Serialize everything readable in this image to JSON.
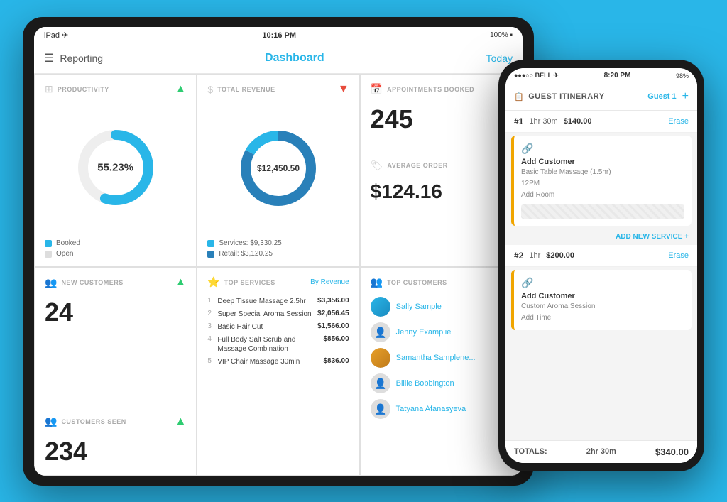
{
  "tablet": {
    "status": {
      "left": "iPad ✈",
      "time": "10:16 PM",
      "battery": "100% ▪"
    },
    "nav": {
      "menu_icon": "☰",
      "title_left": "Reporting",
      "title_center": "Dashboard",
      "title_right": "Today"
    },
    "productivity": {
      "label": "PRODUCTIVITY",
      "value": "55.23%",
      "booked_label": "Booked",
      "open_label": "Open",
      "booked_pct": 55.23,
      "trend": "up"
    },
    "revenue": {
      "label": "TOTAL REVENUE",
      "value": "$12,450.50",
      "services_label": "Services: $9,330.25",
      "retail_label": "Retail: $3,120.25",
      "trend": "down"
    },
    "appointments": {
      "label": "APPOINTMENTS BOOKED",
      "value": "245",
      "trend": "up"
    },
    "new_customers": {
      "label": "NEW CUSTOMERS",
      "value": "24",
      "trend": "up"
    },
    "top_services": {
      "label": "TOP SERVICES",
      "filter": "By Revenue",
      "items": [
        {
          "rank": 1,
          "name": "Deep Tissue Massage 2.5hr",
          "price": "$3,356.00"
        },
        {
          "rank": 2,
          "name": "Super Special Aroma Session",
          "price": "$2,056.45"
        },
        {
          "rank": 3,
          "name": "Basic Hair Cut",
          "price": "$1,566.00"
        },
        {
          "rank": 4,
          "name": "Full Body Salt Scrub and Massage Combination",
          "price": "$856.00"
        },
        {
          "rank": 5,
          "name": "VIP Chair Massage 30min",
          "price": "$836.00"
        }
      ]
    },
    "avg_order": {
      "label": "AVERAGE ORDER",
      "value": "$124.16"
    },
    "top_customers": {
      "label": "TOP CUSTOMERS",
      "items": [
        {
          "name": "Sally Sample",
          "has_avatar": true
        },
        {
          "name": "Jenny Examplie",
          "has_avatar": false
        },
        {
          "name": "Samantha Samplene...",
          "has_avatar": true
        },
        {
          "name": "Billie Bobbington",
          "has_avatar": false
        },
        {
          "name": "Tatyana Afanasyeva",
          "has_avatar": false
        }
      ]
    },
    "customers_seen": {
      "label": "CUSTOMERS SEEN",
      "value": "234",
      "trend": "up"
    }
  },
  "phone": {
    "status": {
      "carrier": "●●●○○ BELL ✈",
      "time": "8:20 PM",
      "battery": "98%"
    },
    "nav": {
      "icon": "📋",
      "title": "GUEST ITINERARY",
      "guest": "Guest 1",
      "plus": "+"
    },
    "slot1": {
      "number": "#1",
      "duration": "1hr 30m",
      "price": "$140.00",
      "erase": "Erase",
      "add_customer": "Add Customer",
      "service": "Basic Table Massage (1.5hr)",
      "time": "12PM",
      "add_room": "Add Room"
    },
    "add_service": "ADD NEW SERVICE +",
    "slot2": {
      "number": "#2",
      "duration": "1hr",
      "price": "$200.00",
      "erase": "Erase",
      "add_customer": "Add Customer",
      "service": "Custom Aroma Session",
      "add_time": "Add Time"
    },
    "footer": {
      "totals_label": "TOTALS:",
      "duration": "2hr 30m",
      "amount": "$340.00"
    }
  }
}
